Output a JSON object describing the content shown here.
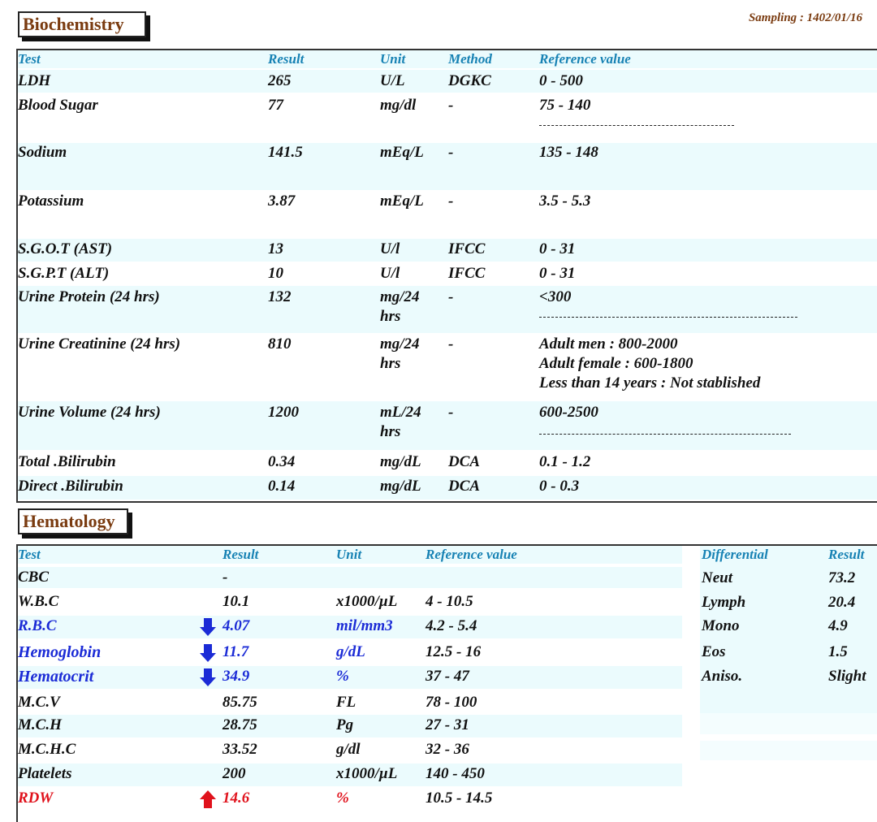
{
  "biochemistry": {
    "title": "Biochemistry",
    "sampling": "Sampling : 1402/01/16",
    "headers": {
      "test": "Test",
      "result": "Result",
      "unit": "Unit",
      "method": "Method",
      "ref": "Reference value"
    },
    "rows": [
      {
        "test": "LDH",
        "result": "265",
        "unit": "U/L",
        "method": "DGKC",
        "ref": "0 - 500"
      },
      {
        "test": "Blood Sugar",
        "result": "77",
        "unit": "mg/dl",
        "method": "-",
        "ref": "75 - 140"
      },
      {
        "test": "Sodium",
        "result": "141.5",
        "unit": "mEq/L",
        "method": "-",
        "ref": "135 - 148"
      },
      {
        "test": "Potassium",
        "result": "3.87",
        "unit": "mEq/L",
        "method": "-",
        "ref": "3.5 - 5.3"
      },
      {
        "test": "S.G.O.T (AST)",
        "result": "13",
        "unit": "U/l",
        "method": "IFCC",
        "ref": "0 - 31"
      },
      {
        "test": "S.G.P.T (ALT)",
        "result": "10",
        "unit": "U/l",
        "method": "IFCC",
        "ref": "0 - 31"
      },
      {
        "test": "Urine Protein (24 hrs)",
        "result": "132",
        "unit": "mg/24",
        "unit2": "hrs",
        "method": "-",
        "ref": "<300"
      },
      {
        "test": "Urine Creatinine (24 hrs)",
        "result": "810",
        "unit": "mg/24",
        "unit2": "hrs",
        "method": "-",
        "ref": "Adult men : 800-2000",
        "ref2": "Adult female : 600-1800",
        "ref3": "Less than 14 years : Not stablished"
      },
      {
        "test": "Urine Volume (24 hrs)",
        "result": "1200",
        "unit": "mL/24",
        "unit2": "hrs",
        "method": "-",
        "ref": "600-2500"
      },
      {
        "test": "Total .Bilirubin",
        "result": "0.34",
        "unit": "mg/dL",
        "method": "DCA",
        "ref": "0.1 - 1.2"
      },
      {
        "test": "Direct .Bilirubin",
        "result": "0.14",
        "unit": "mg/dL",
        "method": "DCA",
        "ref": "0 - 0.3"
      }
    ]
  },
  "hematology": {
    "title": "Hematology",
    "headers": {
      "test": "Test",
      "result": "Result",
      "unit": "Unit",
      "ref": "Reference value",
      "diff": "Differential",
      "diff_result": "Result"
    },
    "rows": [
      {
        "test": "CBC",
        "result": "-",
        "unit": "",
        "ref": "",
        "flag": "none"
      },
      {
        "test": "W.B.C",
        "result": "10.1",
        "unit": "x1000/µL",
        "ref": "4 - 10.5",
        "flag": "none"
      },
      {
        "test": "R.B.C",
        "result": "4.07",
        "unit": "mil/mm3",
        "ref": "4.2 - 5.4",
        "flag": "low"
      },
      {
        "test": "Hemoglobin",
        "result": "11.7",
        "unit": "g/dL",
        "ref": "12.5 - 16",
        "flag": "low"
      },
      {
        "test": "Hematocrit",
        "result": "34.9",
        "unit": "%",
        "ref": "37 - 47",
        "flag": "low"
      },
      {
        "test": "M.C.V",
        "result": "85.75",
        "unit": "FL",
        "ref": "78 - 100",
        "flag": "none"
      },
      {
        "test": "M.C.H",
        "result": "28.75",
        "unit": "Pg",
        "ref": "27 - 31",
        "flag": "none"
      },
      {
        "test": "M.C.H.C",
        "result": "33.52",
        "unit": "g/dl",
        "ref": "32 - 36",
        "flag": "none"
      },
      {
        "test": "Platelets",
        "result": "200",
        "unit": "x1000/µL",
        "ref": "140 - 450",
        "flag": "none"
      },
      {
        "test": "RDW",
        "result": "14.6",
        "unit": "%",
        "ref": "10.5 - 14.5",
        "flag": "high"
      }
    ],
    "differential": [
      {
        "name": "Neut",
        "result": "73.2"
      },
      {
        "name": "Lymph",
        "result": "20.4"
      },
      {
        "name": "Mono",
        "result": "4.9"
      },
      {
        "name": "Eos",
        "result": "1.5"
      },
      {
        "name": "Aniso.",
        "result": "Slight"
      }
    ]
  },
  "colors": {
    "header": "#1782b4",
    "title": "#7a3b10",
    "low": "#1b2bd6",
    "high": "#e0121c",
    "shade": "#ebfbfd"
  },
  "icons": {
    "low": "down-arrow-icon",
    "high": "up-arrow-icon"
  }
}
